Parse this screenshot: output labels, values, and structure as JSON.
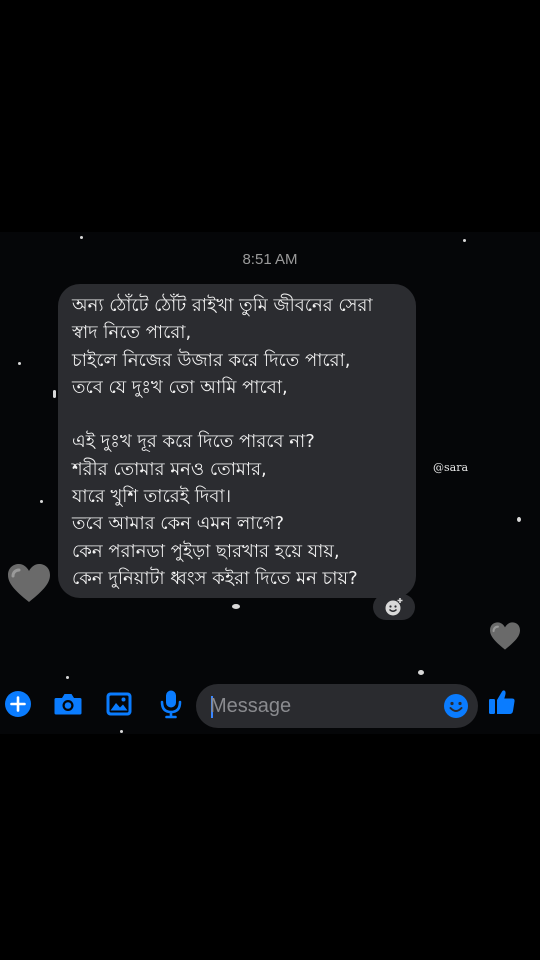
{
  "conversation": {
    "timestamp": "8:51 AM"
  },
  "message": {
    "lines": [
      "অন্য ঠোঁটে ঠোঁট রাইখা তুমি জীবনের সেরা",
      "স্বাদ নিতে পারো,",
      "চাইলে নিজের উজার করে দিতে পারো,",
      "তবে যে দুঃখ তো আমি পাবো,",
      "",
      "এই দুঃখ দূর করে দিতে পারবে না?",
      "শরীর তোমার মনও তোমার,",
      "যারে খুশি তারেই দিবা।",
      "তবে আমার কেন এমন লাগে?",
      "কেন পরানডা পুইড়া ছারখার হয়ে যায়,",
      "কেন দুনিয়াটা ধ্বংস কইরা দিতে মন চায়?"
    ]
  },
  "overlay": {
    "watermark": "@sara"
  },
  "composer": {
    "placeholder": "Message",
    "icons": [
      "plus-icon",
      "camera-icon",
      "gallery-icon",
      "microphone-icon",
      "emoji-icon",
      "thumbs-up-icon"
    ],
    "accent_color": "#0a7cff"
  },
  "colors": {
    "background": "#000000",
    "bubble": "#2b2c30",
    "text": "#f2f2f2",
    "timestamp": "#9a9a9a"
  }
}
